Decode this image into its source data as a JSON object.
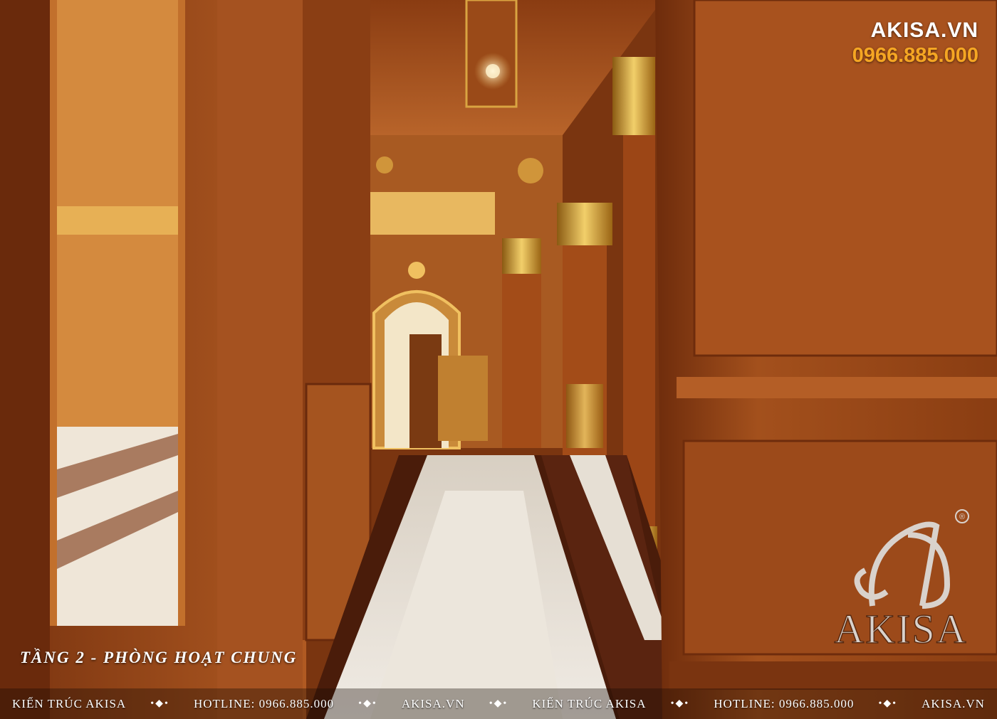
{
  "brand": {
    "name": "AKISA.VN",
    "phone": "0966.885.000"
  },
  "caption": "TẦNG 2 - PHÒNG HOẠT CHUNG",
  "footer": {
    "items": [
      "KIẾN TRÚC AKISA",
      "HOTLINE: 0966.885.000",
      "AKISA.VN",
      "KIẾN TRÚC AKISA",
      "HOTLINE: 0966.885.000",
      "AKISA.VN"
    ],
    "separator": "•◆•"
  },
  "logo": {
    "wordmark": "AKISA",
    "registered": "®"
  },
  "colors": {
    "wood": "#9a4516",
    "gold": "#d9a441",
    "marble": "#e9e4dc",
    "accent_phone": "#f5a623"
  }
}
